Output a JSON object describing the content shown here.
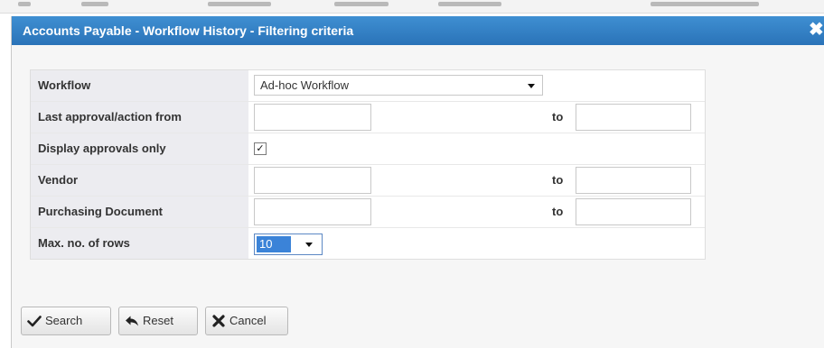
{
  "dialog": {
    "title": "Accounts Payable - Workflow History - Filtering criteria",
    "close_icon": "close-icon"
  },
  "form": {
    "workflow": {
      "label": "Workflow",
      "value": "Ad-hoc Workflow"
    },
    "last_approval": {
      "label": "Last approval/action from",
      "to_label": "to",
      "from_value": "",
      "to_value": ""
    },
    "display_approvals": {
      "label": "Display approvals only",
      "checked": true
    },
    "vendor": {
      "label": "Vendor",
      "to_label": "to",
      "from_value": "",
      "to_value": ""
    },
    "purchasing_document": {
      "label": "Purchasing Document",
      "to_label": "to",
      "from_value": "",
      "to_value": ""
    },
    "max_rows": {
      "label": "Max. no. of rows",
      "value": "10"
    }
  },
  "buttons": {
    "search": {
      "label": "Search",
      "icon": "checkmark-icon"
    },
    "reset": {
      "label": "Reset",
      "icon": "reply-arrow-icon"
    },
    "cancel": {
      "label": "Cancel",
      "icon": "x-icon"
    }
  },
  "colors": {
    "title_bar": "#2f7fc4",
    "label_bg": "#ececf0",
    "selection": "#3b83d8"
  }
}
